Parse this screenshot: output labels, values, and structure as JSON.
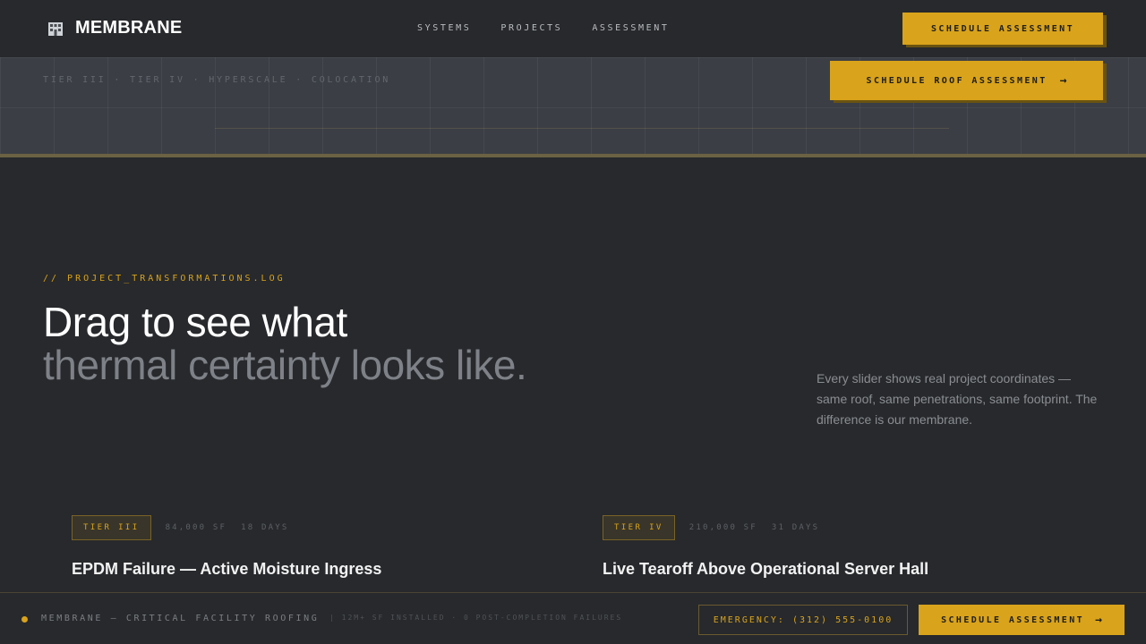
{
  "brand": {
    "name": "MEMBRANE",
    "icon": "building-icon"
  },
  "nav": {
    "links": [
      "SYSTEMS",
      "PROJECTS",
      "ASSESSMENT"
    ],
    "cta_label": "SCHEDULE ASSESSMENT"
  },
  "band": {
    "tags": "TIER III · TIER IV · HYPERSCALE · COLOCATION",
    "cta_label": "SCHEDULE ROOF ASSESSMENT",
    "cta_icon": "arrow-right-icon"
  },
  "hero": {
    "eyebrow": "// PROJECT_TRANSFORMATIONS.LOG",
    "headline_line1": "Drag to see what",
    "headline_line2": "thermal certainty looks like.",
    "intro": "Every slider shows real project coordinates — same roof, same penetrations, same footprint. The difference is our membrane."
  },
  "projects": [
    {
      "tier": "TIER III",
      "area": "84,000 SF",
      "duration": "18 DAYS",
      "title": "EPDM Failure — Active Moisture Ingress"
    },
    {
      "tier": "TIER IV",
      "area": "210,000 SF",
      "duration": "31 DAYS",
      "title": "Live Tearoff Above Operational Server Hall"
    }
  ],
  "footer": {
    "brand": "MEMBRANE — CRITICAL FACILITY ROOFING",
    "stats": "| 12M+ SF INSTALLED · 0 POST-COMPLETION FAILURES",
    "emergency_label": "EMERGENCY: (312) 555-0100",
    "cta_label": "SCHEDULE ASSESSMENT",
    "cta_icon": "arrow-right-icon"
  },
  "colors": {
    "accent": "#d9a31b",
    "background": "#27292c",
    "band": "#3b3e45"
  }
}
